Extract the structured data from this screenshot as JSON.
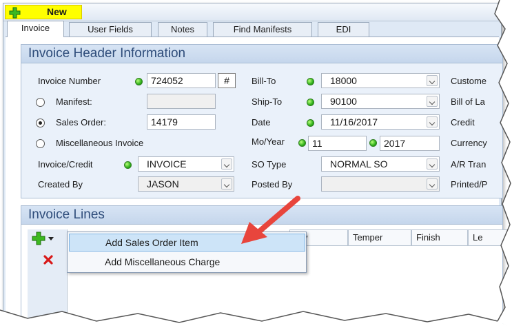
{
  "toolbar": {
    "new_label": "New",
    "new_icon": "green-plus-icon"
  },
  "tabs": [
    {
      "label": "Invoice",
      "active": true
    },
    {
      "label": "User Fields"
    },
    {
      "label": "Notes"
    },
    {
      "label": "Find Manifests"
    },
    {
      "label": "EDI"
    }
  ],
  "header": {
    "title": "Invoice Header Information",
    "invoice_number": {
      "label": "Invoice Number",
      "value": "724052",
      "hash": "#"
    },
    "manifest": {
      "label": "Manifest:",
      "value": ""
    },
    "sales_order": {
      "label": "Sales Order:",
      "value": "14179"
    },
    "misc_invoice": {
      "label": "Miscellaneous Invoice"
    },
    "invoice_credit": {
      "label": "Invoice/Credit",
      "value": "INVOICE"
    },
    "created_by": {
      "label": "Created By",
      "value": "JASON"
    },
    "bill_to": {
      "label": "Bill-To",
      "value": "18000"
    },
    "ship_to": {
      "label": "Ship-To",
      "value": "90100"
    },
    "date": {
      "label": "Date",
      "value": "11/16/2017"
    },
    "mo_year": {
      "label": "Mo/Year",
      "month": "11",
      "year": "2017"
    },
    "so_type": {
      "label": "SO Type",
      "value": "NORMAL SO"
    },
    "posted_by": {
      "label": "Posted By",
      "value": ""
    },
    "right_labels": [
      "Custome",
      "Bill of La",
      "Credit",
      "Currency",
      "A/R Tran",
      "Printed/P"
    ]
  },
  "lines": {
    "title": "Invoice Lines",
    "columns": [
      "lloy",
      "Temper",
      "Finish",
      "Le"
    ],
    "menu": [
      "Add Sales Order Item",
      "Add Miscellaneous Charge"
    ],
    "delete_icon": "red-x-icon"
  },
  "colors": {
    "accent_yellow": "#ffff00",
    "header_text": "#2e4c7a",
    "arrow": "#e8453c"
  }
}
